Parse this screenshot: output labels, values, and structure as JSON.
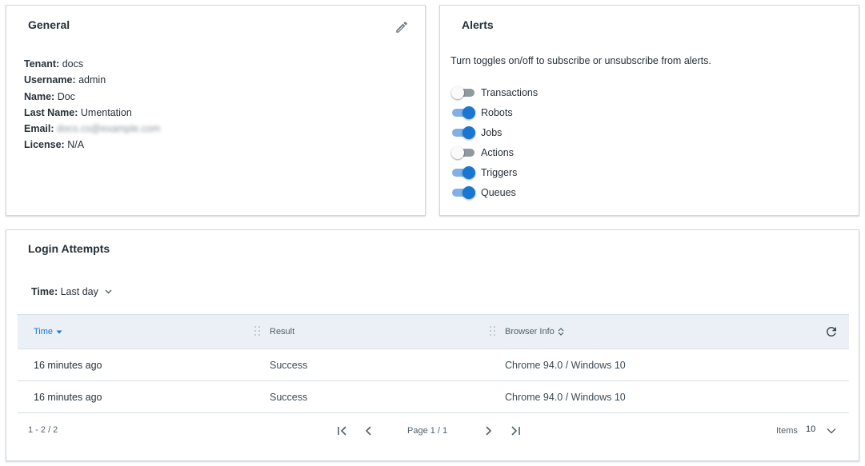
{
  "general": {
    "title": "General",
    "edit_icon": "pencil-icon",
    "fields": [
      {
        "key": "Tenant:",
        "value": "docs"
      },
      {
        "key": "Username:",
        "value": "admin"
      },
      {
        "key": "Name:",
        "value": "Doc"
      },
      {
        "key": "Last Name:",
        "value": "Umentation"
      },
      {
        "key": "Email:",
        "value": "docs.cs@example.com"
      },
      {
        "key": "License:",
        "value": "N/A"
      }
    ]
  },
  "alerts": {
    "title": "Alerts",
    "description": "Turn toggles on/off to subscribe or unsubscribe from alerts.",
    "toggles": [
      {
        "label": "Transactions",
        "on": false
      },
      {
        "label": "Robots",
        "on": true
      },
      {
        "label": "Jobs",
        "on": true
      },
      {
        "label": "Actions",
        "on": false
      },
      {
        "label": "Triggers",
        "on": true
      },
      {
        "label": "Queues",
        "on": true
      }
    ]
  },
  "login": {
    "title": "Login Attempts",
    "time_filter": {
      "key": "Time:",
      "value": "Last day"
    },
    "columns": {
      "time": "Time",
      "result": "Result",
      "browser": "Browser Info"
    },
    "rows": [
      {
        "time": "16 minutes ago",
        "result": "Success",
        "browser": "Chrome 94.0 / Windows 10"
      },
      {
        "time": "16 minutes ago",
        "result": "Success",
        "browser": "Chrome 94.0 / Windows 10"
      }
    ],
    "pager": {
      "range": "1 - 2 / 2",
      "page": "Page 1 / 1",
      "items_label": "Items",
      "items_value": "10"
    }
  },
  "colors": {
    "accent": "#1976d2",
    "header_bg": "#eaf0f6",
    "text": "#273139"
  }
}
